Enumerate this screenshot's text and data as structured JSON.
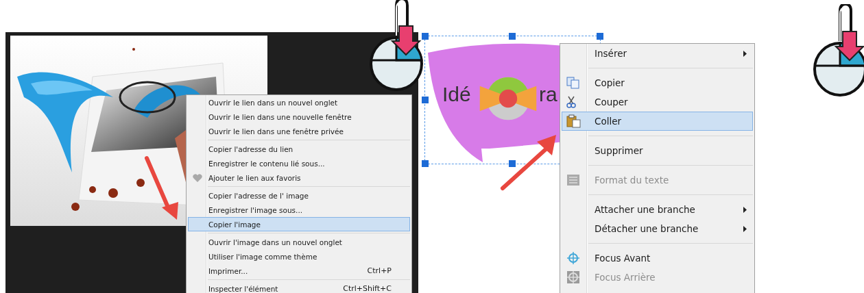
{
  "browser_panel": {
    "context_menu": {
      "groups": [
        [
          {
            "label": "Ouvrir le lien dans un nouvel onglet",
            "selected": false
          },
          {
            "label": "Ouvrir le lien dans une nouvelle fenêtre",
            "selected": false
          },
          {
            "label": "Ouvrir le lien dans une fenêtre privée",
            "selected": false
          }
        ],
        [
          {
            "label": "Copier l'adresse du lien",
            "selected": false
          },
          {
            "label": "Enregistrer le contenu lié sous...",
            "selected": false
          },
          {
            "label": "Ajouter le lien aux favoris",
            "selected": false,
            "kind": "heart"
          }
        ],
        [
          {
            "label": "Copier l'adresse de l' image",
            "selected": false
          },
          {
            "label": "Enregistrer l'image sous...",
            "selected": false
          },
          {
            "label": "Copier l'image",
            "selected": true
          }
        ],
        [
          {
            "label": "Ouvrir l'image dans un nouvel onglet",
            "selected": false
          },
          {
            "label": "Utiliser l'image comme thème",
            "selected": false
          },
          {
            "label": "Imprimer...",
            "shortcut": "Ctrl+P",
            "selected": false
          }
        ],
        [
          {
            "label": "Inspecter l'élément",
            "shortcut": "Ctrl+Shift+C",
            "selected": false
          }
        ]
      ]
    }
  },
  "mindmap_panel": {
    "node": {
      "text_start": "Idé",
      "text_end": "ra",
      "selected": true
    },
    "context_menu": {
      "groups": [
        [
          {
            "label": "Insérer",
            "submenu": true,
            "selected": false,
            "disabled": false
          }
        ],
        [
          {
            "label": "Copier",
            "kind": "copy",
            "selected": false,
            "disabled": false
          },
          {
            "label": "Couper",
            "kind": "cut",
            "selected": false,
            "disabled": false
          },
          {
            "label": "Coller",
            "kind": "paste",
            "selected": true,
            "disabled": false
          }
        ],
        [
          {
            "label": "Supprimer",
            "selected": false,
            "disabled": false
          }
        ],
        [
          {
            "label": "Format du texte",
            "kind": "format",
            "selected": false,
            "disabled": true
          }
        ],
        [
          {
            "label": "Attacher une branche",
            "submenu": true,
            "selected": false,
            "disabled": false
          },
          {
            "label": "Détacher une branche",
            "submenu": true,
            "selected": false,
            "disabled": false
          }
        ],
        [
          {
            "label": "Focus Avant",
            "kind": "focus",
            "selected": false,
            "disabled": false
          },
          {
            "label": "Focus Arrière",
            "kind": "focus",
            "selected": false,
            "disabled": true
          }
        ]
      ]
    }
  }
}
